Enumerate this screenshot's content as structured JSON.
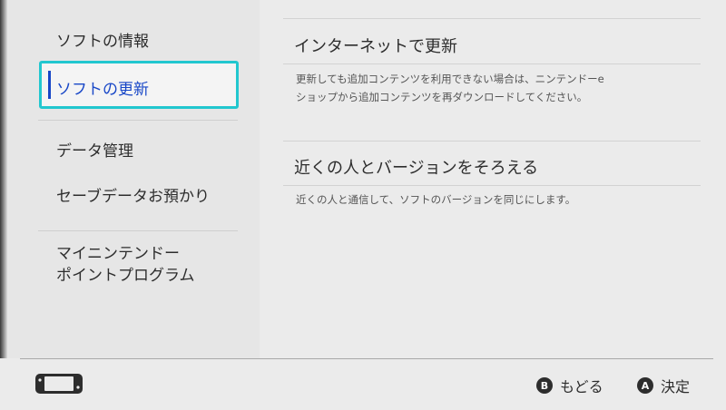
{
  "sidebar": {
    "items": [
      {
        "label": "ソフトの情報"
      },
      {
        "label": "ソフトの更新",
        "selected": true
      },
      {
        "label": "データ管理"
      },
      {
        "label": "セーブデータお預かり"
      },
      {
        "label_lines": [
          "マイニンテンドー",
          "ポイントプログラム"
        ]
      }
    ]
  },
  "main": {
    "options": [
      {
        "title": "インターネットで更新",
        "description_lines": [
          "更新しても追加コンテンツを利用できない場合は、ニンテンドーe",
          "ショップから追加コンテンツを再ダウンロードしてください。"
        ]
      },
      {
        "title": "近くの人とバージョンをそろえる",
        "description_lines": [
          "近くの人と通信して、ソフトのバージョンを同じにします。"
        ]
      }
    ]
  },
  "footer": {
    "console_icon": "handheld-console-icon",
    "back": {
      "button": "B",
      "label": "もどる"
    },
    "confirm": {
      "button": "A",
      "label": "決定"
    }
  },
  "colors": {
    "accent_border": "#22c7cf",
    "selected_text": "#1847c7",
    "background": "#ebebeb"
  }
}
